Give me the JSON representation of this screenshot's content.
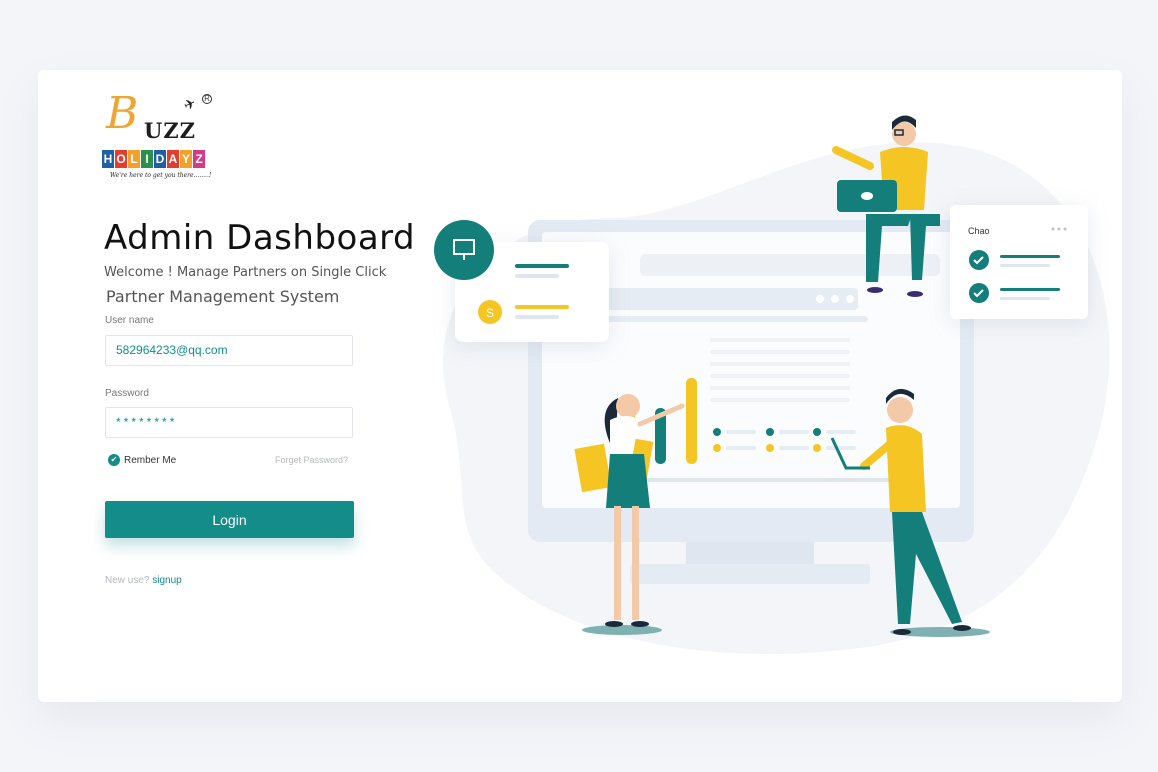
{
  "logo": {
    "b": "B",
    "uzz": "UZZ",
    "holidayz_letters": [
      "H",
      "O",
      "L",
      "I",
      "D",
      "A",
      "Y",
      "Z"
    ],
    "holidayz_colors": [
      "#1f5fa8",
      "#e43d2f",
      "#f2a12b",
      "#2c8f4e",
      "#1f5fa8",
      "#e43d2f",
      "#f2a12b",
      "#d53a87"
    ],
    "tagline": "We're here to get you there........!",
    "tm": "R"
  },
  "header": {
    "title": "Admin Dashboard",
    "welcome": "Welcome !  Manage Partners on  Single Click",
    "system": "Partner Management System"
  },
  "form": {
    "username_label": "User name",
    "username_value": "582964233@qq.com",
    "password_label": "Password",
    "password_value": "********",
    "remember_label": "Rember Me",
    "forgot_label": "Forget Password?",
    "login_label": "Login",
    "new_user_prefix": "New use?",
    "signup_label": "signup"
  },
  "illustration": {
    "chao_label": "Chao",
    "dollar_label": "S"
  },
  "colors": {
    "accent": "#138c8a",
    "yellow": "#f5c623",
    "background": "#f4f5f9"
  }
}
